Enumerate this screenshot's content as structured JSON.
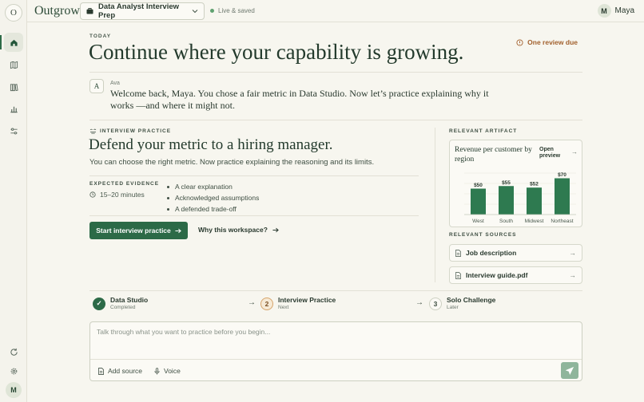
{
  "brand": {
    "logo_letter": "O",
    "name": "Outgrow"
  },
  "workspace": {
    "name": "Data Analyst Interview Prep"
  },
  "status": {
    "saved": "Live & saved"
  },
  "user": {
    "initial": "M",
    "name": "Maya"
  },
  "rail": {
    "avatar_initial": "M"
  },
  "hero": {
    "eyebrow": "TODAY",
    "headline": "Continue where your capability is growing.",
    "review": "One review due"
  },
  "coach": {
    "initial": "A",
    "name": "Ava",
    "message": "Welcome back, Maya. You chose a fair metric in Data Studio. Now let’s practice explaining why it works —and where it might not."
  },
  "task": {
    "label": "INTERVIEW PRACTICE",
    "title": "Defend your metric to a hiring manager.",
    "subtitle": "You can choose the right metric. Now practice explaining the reasoning and its limits.",
    "evidence_label": "EXPECTED EVIDENCE",
    "duration": "15–20 minutes",
    "evidence": [
      "A clear explanation",
      "Acknowledged assumptions",
      "A defended trade-off"
    ],
    "start_label": "Start interview practice",
    "why_label": "Why this workspace?"
  },
  "artifact": {
    "label": "RELEVANT ARTIFACT",
    "title": "Revenue per customer by region",
    "open_label": "Open preview"
  },
  "chart_data": {
    "type": "bar",
    "title": "Revenue per customer by region",
    "categories": [
      "West",
      "South",
      "Midwest",
      "Northeast"
    ],
    "values": [
      50,
      55,
      52,
      70
    ],
    "value_labels": [
      "$50",
      "$55",
      "$52",
      "$70"
    ],
    "ylim": [
      0,
      80
    ],
    "grid": true,
    "bar_color": "#2e7a50"
  },
  "sources": {
    "label": "RELEVANT SOURCES",
    "items": [
      {
        "label": "Job description"
      },
      {
        "label": "Interview guide.pdf"
      }
    ]
  },
  "steps": [
    {
      "marker": "✓",
      "title": "Data Studio",
      "status": "Completed"
    },
    {
      "marker": "2",
      "title": "Interview Practice",
      "status": "Next"
    },
    {
      "marker": "3",
      "title": "Solo Challenge",
      "status": "Later"
    }
  ],
  "composer": {
    "placeholder": "Talk through what you want to practice before you begin...",
    "add_source": "Add source",
    "voice": "Voice"
  },
  "colors": {
    "accent": "#2c6a47",
    "review": "#a2602d",
    "background": "#f7f6ef"
  }
}
